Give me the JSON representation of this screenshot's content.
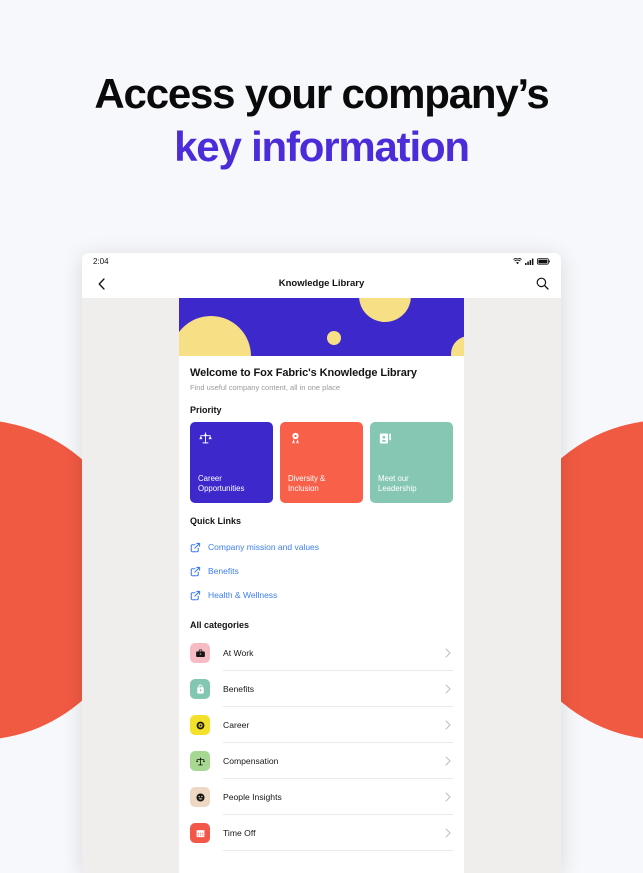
{
  "headline": {
    "line1": "Access your company’s",
    "line2": "key information",
    "accent_color": "#4B2CD8"
  },
  "page": {
    "background_color": "#F7F8FB",
    "decor_circle_color": "#F15A42"
  },
  "device": {
    "statusbar": {
      "clock": "2:04",
      "icons": [
        "wifi-icon",
        "cellular-signal-icon",
        "battery-icon"
      ]
    },
    "navbar": {
      "back_icon": "chevron-left-icon",
      "title": "Knowledge Library",
      "search_icon": "search-icon"
    },
    "hero": {
      "background_color": "#3D28CC",
      "circle_color": "#F6DF85"
    },
    "welcome": {
      "title": "Welcome to Fox Fabric's Knowledge Library",
      "subtitle": "Find useful company content, all in one place"
    },
    "priority": {
      "heading": "Priority",
      "cards": [
        {
          "label": "Career Opportunities",
          "color": "#3D28CC",
          "icon": "scales-icon"
        },
        {
          "label": "Diversity & Inclusion",
          "color": "#F9604A",
          "icon": "ribbon-icon"
        },
        {
          "label": "Meet our Leadership",
          "color": "#85C7B3",
          "icon": "id-badge-icon"
        }
      ]
    },
    "quick_links": {
      "heading": "Quick Links",
      "link_color": "#3D7EF0",
      "items": [
        {
          "label": "Company mission and values",
          "icon": "external-link-icon"
        },
        {
          "label": "Benefits",
          "icon": "external-link-icon"
        },
        {
          "label": "Health & Wellness",
          "icon": "external-link-icon"
        }
      ]
    },
    "categories": {
      "heading": "All categories",
      "chevron_icon": "chevron-right-icon",
      "items": [
        {
          "label": "At Work",
          "tile_color": "#F7BCC3",
          "icon": "briefcase-icon"
        },
        {
          "label": "Benefits",
          "tile_color": "#83C6B2",
          "icon": "shopping-bag-icon"
        },
        {
          "label": "Career",
          "tile_color": "#F2E02B",
          "icon": "target-badge-icon"
        },
        {
          "label": "Compensation",
          "tile_color": "#A7D892",
          "icon": "scales-icon"
        },
        {
          "label": "People Insights",
          "tile_color": "#EED8C4",
          "icon": "smiley-face-icon"
        },
        {
          "label": "Time Off",
          "tile_color": "#F3574A",
          "icon": "calendar-icon"
        }
      ]
    }
  }
}
